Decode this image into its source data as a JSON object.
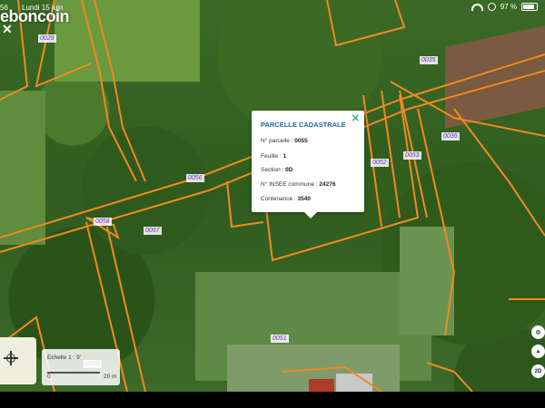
{
  "status_bar": {
    "time": "56",
    "date": "Lundi 15 juin",
    "battery": "97 %"
  },
  "app": {
    "logo": "eboncoin",
    "close_symbol": "✕"
  },
  "parcels": [
    "0029",
    "0035",
    "0036",
    "0052",
    "0053",
    "0055",
    "0056",
    "0057",
    "0058",
    "0051",
    "0059"
  ],
  "popup": {
    "title": "PARCELLE CADASTRALE",
    "close_symbol": "✕",
    "rows": [
      {
        "label": "N° parcelle : ",
        "value": "0055"
      },
      {
        "label": "Feuille : ",
        "value": "1"
      },
      {
        "label": "Section : ",
        "value": "0D"
      },
      {
        "label": "N° INSEE commune : ",
        "value": "24276"
      },
      {
        "label": "Contenance : ",
        "value": "3540"
      }
    ]
  },
  "scale": {
    "text": "Echelle 1 :",
    "suffix": "9'",
    "zero": "0",
    "max": "20 m"
  },
  "map_controls": {
    "mode_2d": "2D"
  },
  "colors": {
    "parcel_line": "#f08a20",
    "parcel_label": "#6a2bd6",
    "popup_title": "#1d6c96",
    "popup_close": "#2bb58c"
  },
  "icons": [
    "wifi-icon",
    "orientation-lock-icon",
    "battery-icon",
    "locate-icon",
    "compass-icon",
    "2d-toggle-icon"
  ]
}
